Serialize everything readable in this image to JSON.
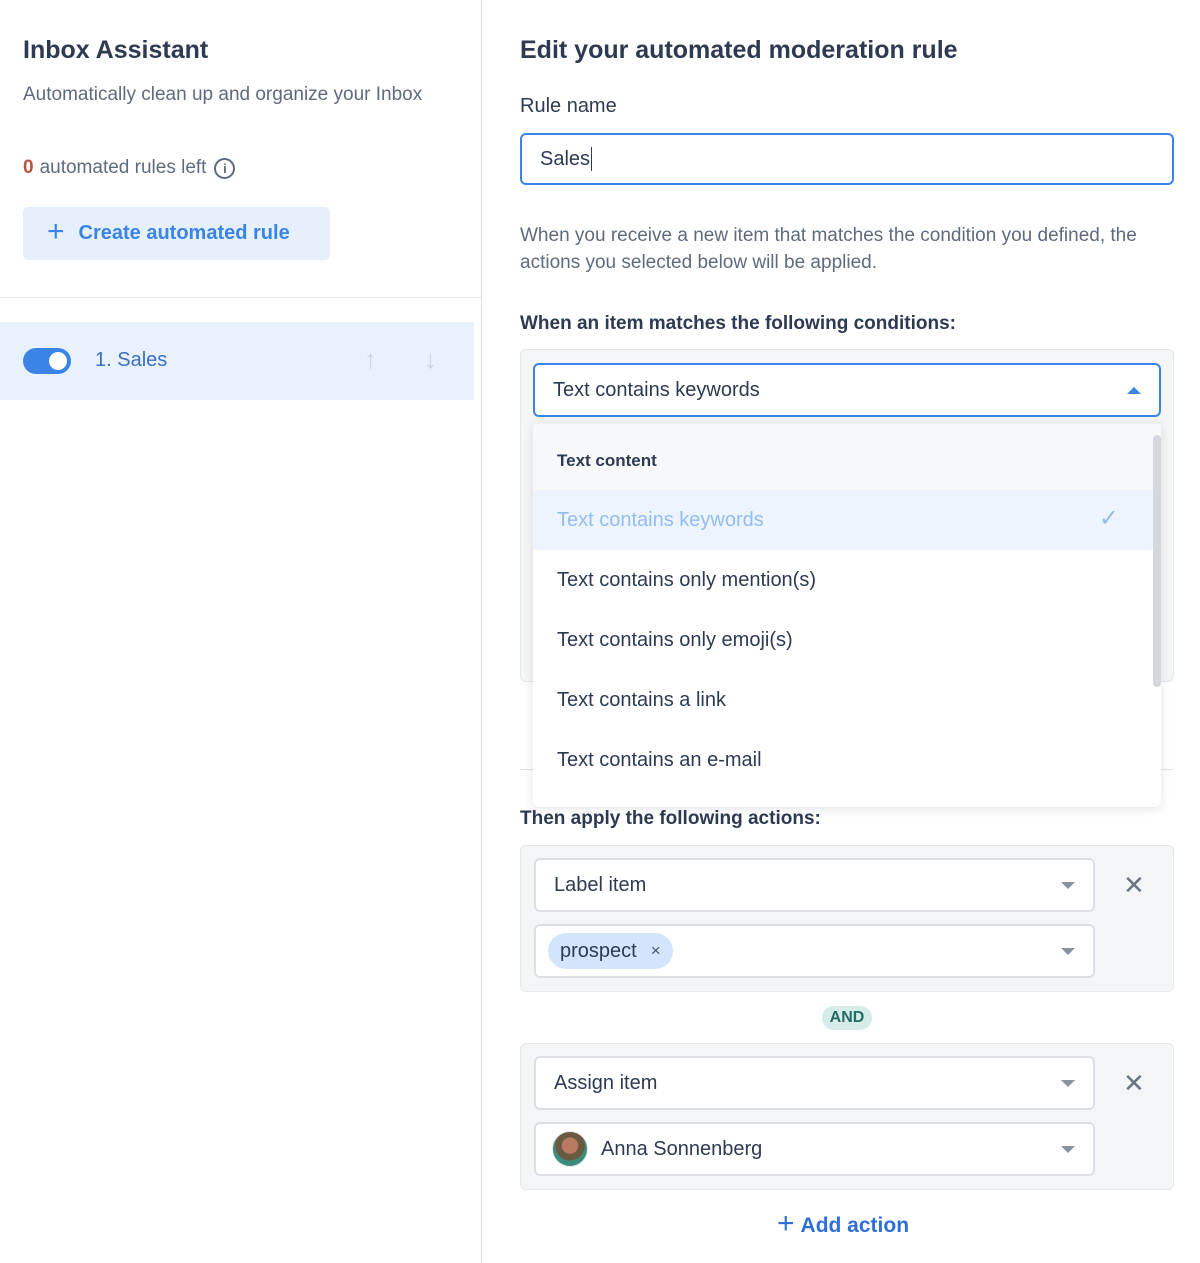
{
  "sidebar": {
    "title": "Inbox Assistant",
    "subtitle": "Automatically clean up and organize your Inbox",
    "rules_left_count": "0",
    "rules_left_text": "automated rules left",
    "create_button_label": "Create automated rule",
    "rules": [
      {
        "label": "1. Sales",
        "enabled": true
      }
    ]
  },
  "editor": {
    "title": "Edit your automated moderation rule",
    "rule_name_label": "Rule name",
    "rule_name_value": "Sales",
    "description": "When you receive a new item that matches the condition you defined, the actions you selected below will be applied.",
    "conditions_heading": "When an item matches the following conditions:",
    "condition_selected": "Text contains keywords",
    "condition_dropdown": {
      "group_label": "Text content",
      "options": [
        {
          "label": "Text contains keywords",
          "selected": true
        },
        {
          "label": "Text contains only mention(s)",
          "selected": false
        },
        {
          "label": "Text contains only emoji(s)",
          "selected": false
        },
        {
          "label": "Text contains a link",
          "selected": false
        },
        {
          "label": "Text contains an e-mail",
          "selected": false
        }
      ]
    },
    "actions_heading": "Then apply the following actions:",
    "actions": [
      {
        "type": "Label item",
        "value_chip": "prospect"
      },
      {
        "type": "Assign item",
        "assignee": "Anna Sonnenberg"
      }
    ],
    "and_label": "AND",
    "add_action_label": "Add action"
  },
  "icons": {
    "plus": "+",
    "info": "i",
    "arrow_up": "↑",
    "arrow_down": "↓",
    "check": "✓",
    "close": "✕",
    "chip_close": "×"
  },
  "colors": {
    "accent": "#3a84e8",
    "warning_count": "#b4553d",
    "and_badge_bg": "#d5ece9",
    "and_badge_text": "#236b63"
  }
}
